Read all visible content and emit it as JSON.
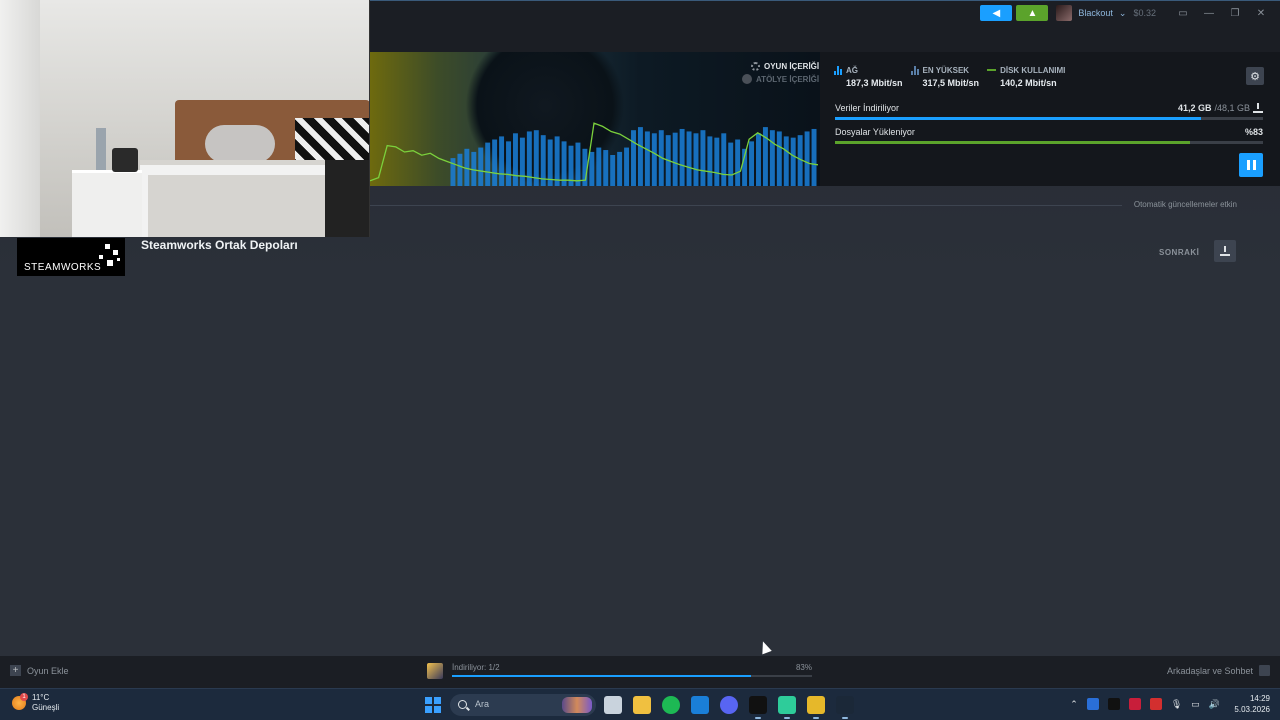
{
  "titlebar": {
    "account_name": "Blackout",
    "balance": "$0.32",
    "announcement_icon": "megaphone-icon",
    "notification_icon": "bell-icon"
  },
  "downloads": {
    "content_types": {
      "game": "OYUN İÇERİĞİ",
      "workshop": "ATÖLYE İÇERİĞİ"
    },
    "stats": {
      "network_label": "AĞ",
      "network_value": "187,3 Mbit/sn",
      "peak_label": "EN YÜKSEK",
      "peak_value": "317,5 Mbit/sn",
      "disk_label": "DİSK KULLANIMI",
      "disk_value": "140,2 Mbit/sn"
    },
    "download_label": "Veriler İndiriliyor",
    "download_done": "41,2 GB",
    "download_total": "/48,1 GB",
    "download_fraction": 0.856,
    "install_label": "Dosyalar Yükleniyor",
    "install_value": "%83",
    "install_fraction": 0.83,
    "auto_updates": "Otomatik güncellemeler etkin",
    "graph_network": [
      0.45,
      0.52,
      0.6,
      0.55,
      0.62,
      0.7,
      0.75,
      0.8,
      0.72,
      0.85,
      0.78,
      0.88,
      0.9,
      0.82,
      0.75,
      0.8,
      0.72,
      0.65,
      0.7,
      0.6,
      0.55,
      0.62,
      0.58,
      0.5,
      0.55,
      0.62,
      0.9,
      0.95,
      0.88,
      0.85,
      0.9,
      0.82,
      0.86,
      0.92,
      0.88,
      0.85,
      0.9,
      0.8,
      0.78,
      0.85,
      0.7,
      0.75,
      0.6,
      0.72,
      0.85,
      0.95,
      0.9,
      0.88,
      0.8,
      0.78,
      0.82,
      0.88,
      0.92
    ],
    "graph_disk": [
      0.05,
      0.1,
      0.6,
      0.58,
      0.5,
      0.52,
      0.45,
      0.48,
      0.4,
      0.35,
      0.3,
      0.25,
      0.22,
      0.2,
      0.18,
      0.16,
      0.15,
      0.13,
      0.12,
      0.1,
      0.08,
      0.07,
      0.06,
      0.06,
      0.05,
      0.06,
      0.95,
      0.9,
      0.82,
      0.78,
      0.7,
      0.62,
      0.55,
      0.48,
      0.4,
      0.35,
      0.3,
      0.26,
      0.22,
      0.2,
      0.18,
      0.15,
      0.14,
      0.2,
      0.7,
      0.8,
      0.72,
      0.62,
      0.55,
      0.45,
      0.38,
      0.32,
      0.3
    ]
  },
  "next": {
    "app_title": "Steamworks Ortak Depoları",
    "logo_text": "STEAMWORKS",
    "next_label": "SONRAKİ"
  },
  "footer": {
    "add_game": "Oyun Ekle",
    "download_status": "İndiriliyor: 1/2",
    "download_percent": "83%",
    "download_fraction": 0.83,
    "friends_chat": "Arkadaşlar ve Sohbet"
  },
  "taskbar": {
    "weather_temp": "11°C",
    "weather_cond": "Güneşli",
    "weather_badge": "1",
    "search_placeholder": "Ara",
    "time": "14:29",
    "date": "5.03.2026",
    "apps": [
      {
        "name": "file-viewer-icon",
        "color": "#c9d3dd"
      },
      {
        "name": "file-explorer-icon",
        "color": "#f0c040"
      },
      {
        "name": "spotify-icon",
        "color": "#1db954"
      },
      {
        "name": "mail-icon",
        "color": "#1a7fd8"
      },
      {
        "name": "discord-icon",
        "color": "#5865f2"
      },
      {
        "name": "audio-meter-icon",
        "color": "#111111"
      },
      {
        "name": "game-launcher-icon",
        "color": "#2ecc9a"
      },
      {
        "name": "chrome-icon",
        "color": "#e6b82a"
      },
      {
        "name": "steam-icon",
        "color": "#1b2838"
      }
    ]
  }
}
